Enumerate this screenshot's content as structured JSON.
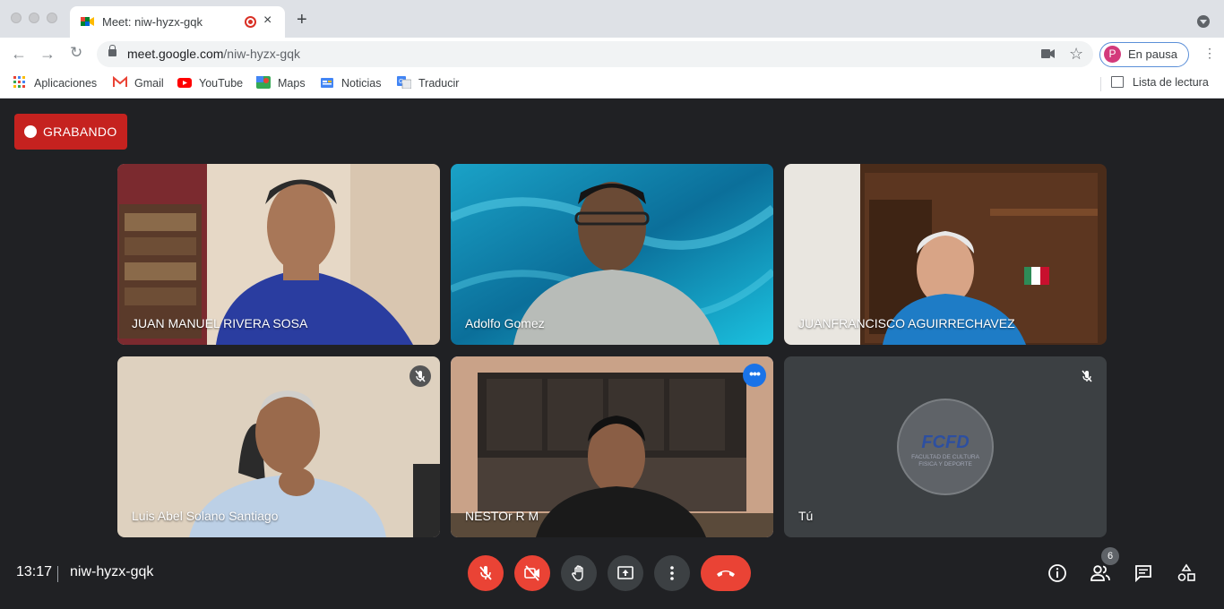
{
  "browser": {
    "tab_title": "Meet: niw-hyzx-gqk",
    "url_host": "meet.google.com",
    "url_path": "/niw-hyzx-gqk",
    "profile_initial": "P",
    "profile_label": "En pausa"
  },
  "bookmarks": {
    "items": [
      "Aplicaciones",
      "Gmail",
      "YouTube",
      "Maps",
      "Noticias",
      "Traducir"
    ],
    "reading_list": "Lista de lectura"
  },
  "meet": {
    "recording_label": "GRABANDO",
    "participants": [
      "JUAN MANUEL RIVERA SOSA",
      "Adolfo Gomez",
      "JUANFRANCISCO AGUIRRECHAVEZ",
      "Luis Abel Solano Santiago",
      "NESTOr R M",
      "Tú"
    ],
    "self_logo_text": "FCFD",
    "self_logo_sub1": "FACULTAD DE CULTURA",
    "self_logo_sub2": "FISICA Y DEPORTE",
    "time": "13:17",
    "meeting_code": "niw-hyzx-gqk",
    "people_count": "6"
  },
  "colors": {
    "accent": "#1a73e8",
    "danger": "#ea4335",
    "recording": "#c5221f"
  }
}
